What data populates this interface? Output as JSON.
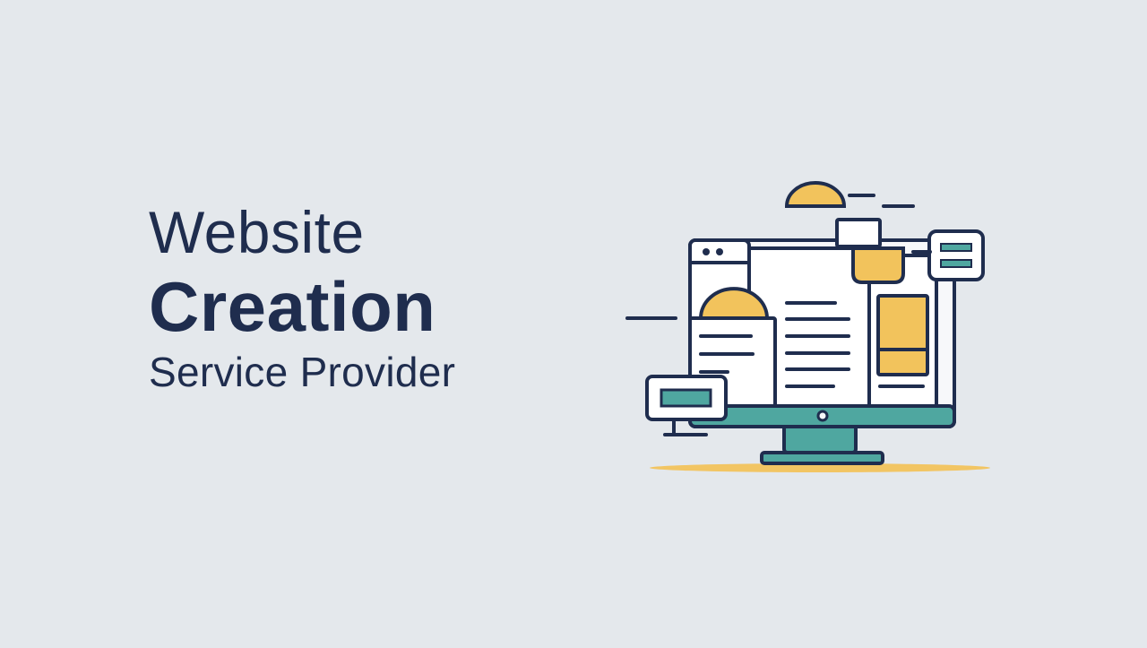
{
  "hero": {
    "line1": "Website",
    "line2": "Creation",
    "line3": "Service Provider"
  },
  "illustration": {
    "icon": "computer-monitor-web-design-illustration"
  },
  "colors": {
    "background": "#e4e8ec",
    "text": "#1f2d4e",
    "accent_yellow": "#f2c35c",
    "accent_teal": "#4fa7a0",
    "outline": "#1f2d4e",
    "panel": "#f7f8fa"
  }
}
